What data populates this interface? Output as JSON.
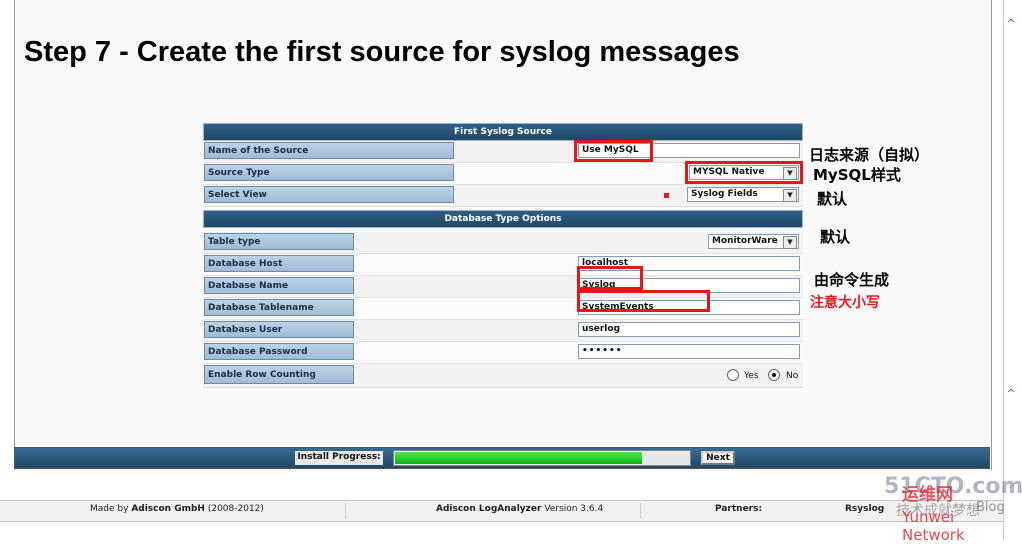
{
  "step_title": "Step 7 - Create the first source for syslog messages",
  "section_first_source": "First Syslog Source",
  "section_db_options": "Database Type Options",
  "fields": {
    "source_name": {
      "label": "Name of the Source",
      "value": "Use MySQL"
    },
    "source_type": {
      "label": "Source Type",
      "value": "MYSQL Native"
    },
    "select_view": {
      "label": "Select View",
      "value": "Syslog Fields"
    },
    "table_type": {
      "label": "Table type",
      "value": "MonitorWare"
    },
    "db_host": {
      "label": "Database Host",
      "value": "localhost"
    },
    "db_name": {
      "label": "Database Name",
      "value": "Syslog"
    },
    "db_tablename": {
      "label": "Database Tablename",
      "value": "SystemEvents"
    },
    "db_user": {
      "label": "Database User",
      "value": "userlog"
    },
    "db_password": {
      "label": "Database Password",
      "value": "••••••"
    },
    "row_counting": {
      "label": "Enable Row Counting",
      "yes": "Yes",
      "no": "No",
      "selected": "No"
    }
  },
  "annotations": {
    "source_name": "日志来源（自拟）",
    "source_type": "MySQL样式",
    "select_view": "默认",
    "table_type": "默认",
    "db_name": "由命令生成",
    "db_tablename": "注意大小写"
  },
  "progress": {
    "label": "Install Progress:",
    "fraction": 0.84,
    "next": "Next"
  },
  "footer": {
    "made_by_prefix": "Made by",
    "made_by_company": "Adiscon GmbH",
    "made_by_years": "(2008-2012)",
    "product": "Adiscon LogAnalyzer",
    "version": "Version 3.6.4",
    "partners": "Partners:",
    "partner_name": "Rsyslog"
  },
  "watermark": {
    "num": "51CTO.com",
    "cn": "运维网",
    "cn2": "技术成就梦想",
    "blog": "Blog",
    "text": "Yunwei Network"
  },
  "colors": {
    "accent_red": "#e8151b",
    "header_blue": "#1f4868",
    "progress_green": "#0db20d"
  }
}
